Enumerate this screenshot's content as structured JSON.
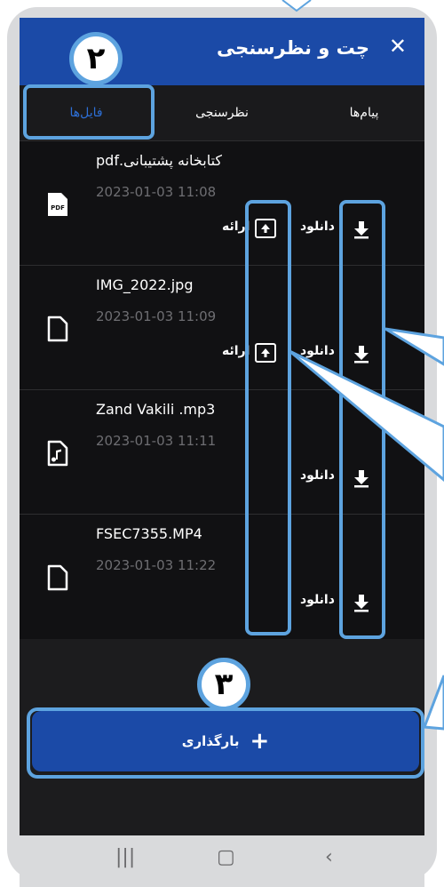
{
  "header": {
    "title": "چت و نظرسنجی",
    "close_icon": "close-icon"
  },
  "tabs": [
    {
      "label": "پیام‌ها"
    },
    {
      "label": "نظرسنجی"
    },
    {
      "label": "فایل‌ها"
    }
  ],
  "files": [
    {
      "name": "کتابخانه پشتیبانی.pdf",
      "date": "2023-01-03 11:08",
      "icon": "pdf-file-icon",
      "download_label": "دانلود",
      "present_label": "ارائه"
    },
    {
      "name": "IMG_2022.jpg",
      "date": "2023-01-03 11:09",
      "icon": "file-icon",
      "download_label": "دانلود",
      "present_label": "ارائه"
    },
    {
      "name": "Zand Vakili .mp3",
      "date": "2023-01-03 11:11",
      "icon": "audio-file-icon",
      "download_label": "دانلود"
    },
    {
      "name": "FSEC7355.MP4",
      "date": "2023-01-03 11:22",
      "icon": "file-icon",
      "download_label": "دانلود"
    }
  ],
  "upload": {
    "label": "بارگذاری"
  },
  "annotations": {
    "badge_2": "۲",
    "badge_3": "۳"
  },
  "colors": {
    "header": "#1b4aa7",
    "accent": "#2d6fd6",
    "highlight": "#5da3df"
  }
}
